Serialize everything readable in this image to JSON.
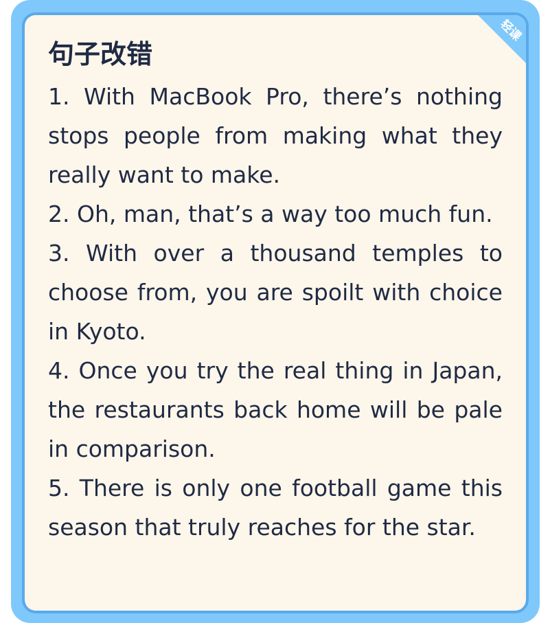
{
  "card": {
    "title": "句子改错",
    "tag": "轻课",
    "sentences": [
      "1. With MacBook Pro, there’s nothing stops people from making what they really want to make.",
      "2. Oh, man, that’s a way too much fun.",
      "3. With over a thousand temples to choose from, you are spoilt with choice in Kyoto.",
      "4. Once you try the real thing in Japan, the restaurants back home will be pale in comparison.",
      "5. There is only one football game this season that truly reaches for the star."
    ]
  },
  "colors": {
    "frame_outer": "#7fc8fb",
    "frame_inner": "#5aa9ea",
    "card_background": "#fdf6ea",
    "text": "#1f2a44",
    "tag": "#7fc8fb"
  }
}
